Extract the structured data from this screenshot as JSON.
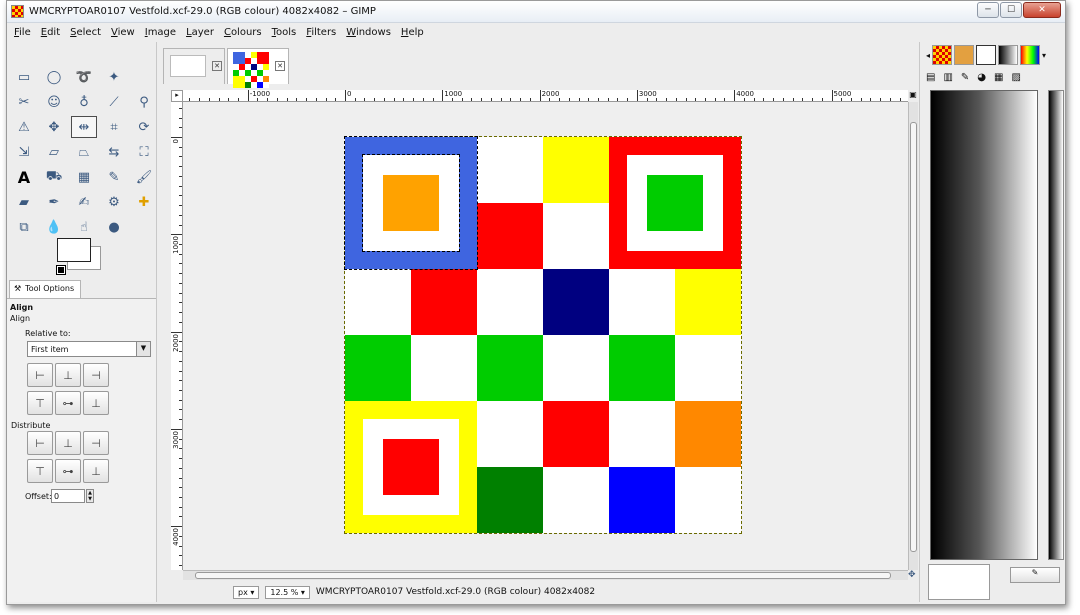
{
  "window": {
    "title": "WMCRYPTOAR0107 Vestfold.xcf-29.0 (RGB colour) 4082x4082 – GIMP",
    "minimize": "─",
    "maximize": "☐",
    "close": "✕"
  },
  "menu": [
    "File",
    "Edit",
    "Select",
    "View",
    "Image",
    "Layer",
    "Colours",
    "Tools",
    "Filters",
    "Windows",
    "Help"
  ],
  "tool_options": {
    "tab_label": "Tool Options",
    "title": "Align",
    "subtitle": "Align",
    "relative_to_label": "Relative to:",
    "relative_to_value": "First item",
    "distribute_label": "Distribute",
    "offset_label": "Offset:",
    "offset_value": "0"
  },
  "rulers": {
    "top": [
      "-1000",
      "0",
      "1000",
      "2000",
      "3000",
      "4000",
      "5000"
    ],
    "left": [
      "0",
      "1000",
      "2000",
      "3000",
      "4000"
    ]
  },
  "status": {
    "unit": "px",
    "zoom": "12.5 %",
    "text": "WMCRYPTOAR0107 Vestfold.xcf-29.0 (RGB colour) 4082x4082"
  },
  "colors": {
    "blue": "#3f65e0",
    "orange": "#ffa200",
    "white": "#ffffff",
    "yellow": "#ffff00",
    "red": "#ff0000",
    "green": "#00cc00",
    "navy": "#000080",
    "dark_green": "#008000",
    "bright_blue": "#0000ff",
    "orange2": "#ff8800"
  },
  "board": {
    "grid": [
      [
        "B",
        "B",
        "W",
        "Y",
        "R",
        "R"
      ],
      [
        "B",
        "B",
        "R",
        "W",
        "R",
        "R"
      ],
      [
        "W",
        "R",
        "W",
        "N",
        "W",
        "Y"
      ],
      [
        "G",
        "W",
        "G",
        "W",
        "G",
        "W"
      ],
      [
        "Y",
        "Y",
        "W",
        "R",
        "W",
        "O"
      ],
      [
        "Y",
        "Y",
        "DG",
        "W",
        "BB",
        "W"
      ]
    ],
    "insets": [
      {
        "row": 0,
        "col": 0,
        "frame": "#3f65e0",
        "inner": "#ffa200"
      },
      {
        "row": 0,
        "col": 4,
        "frame": "#ff0000",
        "inner": "#00cc00"
      },
      {
        "row": 4,
        "col": 0,
        "frame": "#ffff00",
        "inner": "#ff0000"
      }
    ]
  }
}
